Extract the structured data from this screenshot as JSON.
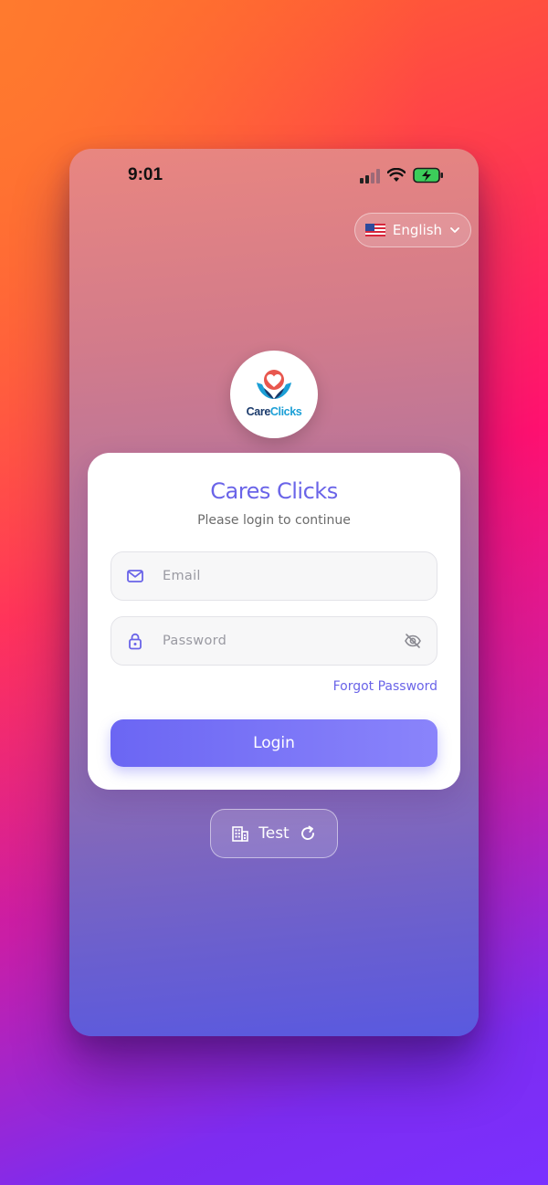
{
  "status_bar": {
    "time": "9:01"
  },
  "language": {
    "flag_icon": "us-flag-icon",
    "label": "English"
  },
  "logo": {
    "text_care": "Care",
    "text_clicks": "Clicks"
  },
  "login_card": {
    "title": "Cares Clicks",
    "subtitle": "Please login to continue",
    "email": {
      "placeholder": "Email",
      "value": ""
    },
    "password": {
      "placeholder": "Password",
      "value": ""
    },
    "forgot_password": "Forgot Password",
    "login_button": "Login"
  },
  "organization": {
    "label": "Test",
    "icon": "building-icon",
    "action_icon": "refresh-icon"
  },
  "colors": {
    "accent": "#6a64e8",
    "button_start": "#6b66f3",
    "button_end": "#8a84fb"
  }
}
